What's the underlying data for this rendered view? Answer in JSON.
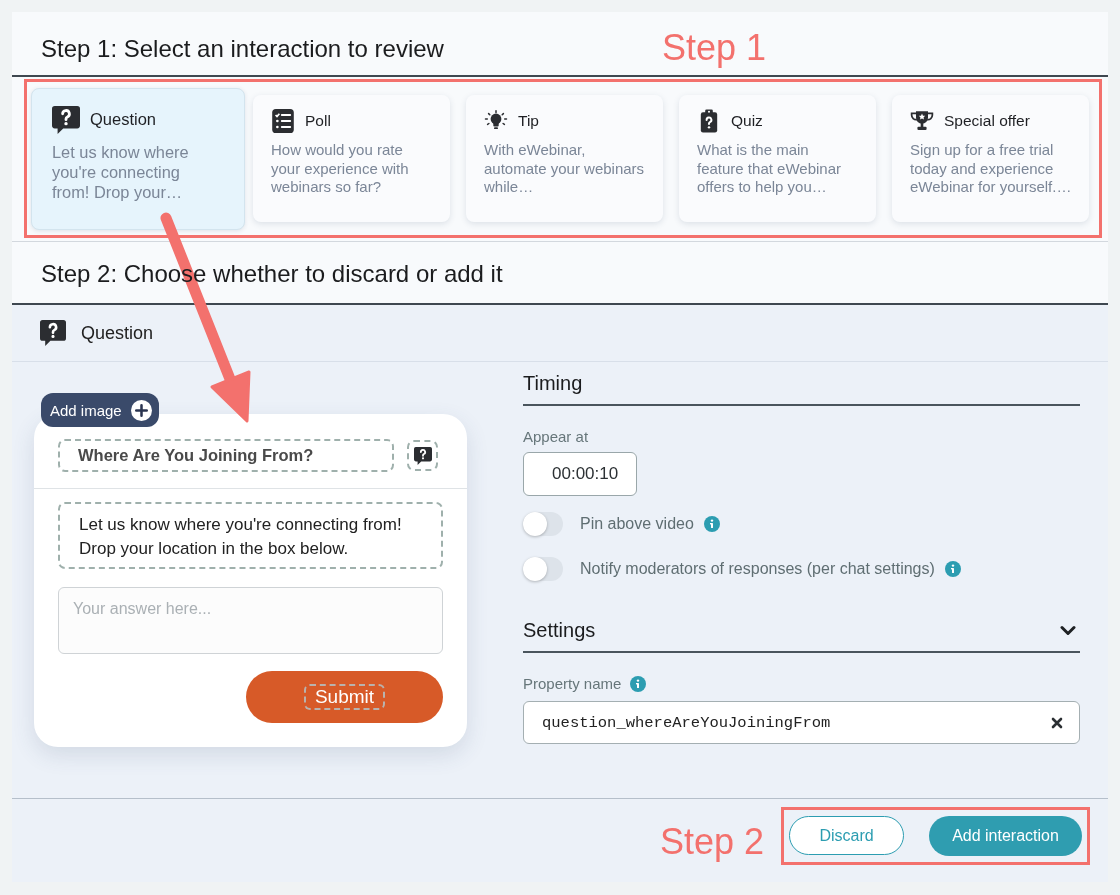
{
  "step1": {
    "title": "Step 1: Select an interaction to review",
    "callout": "Step 1",
    "interactions": [
      {
        "kind": "question",
        "title": "Question",
        "preview": "Let us know where you're connecting from! Drop your…",
        "selected": true
      },
      {
        "kind": "poll",
        "title": "Poll",
        "preview": "How would you rate your experience with webinars so far?",
        "selected": false
      },
      {
        "kind": "tip",
        "title": "Tip",
        "preview": "With eWebinar, automate your webinars while…",
        "selected": false
      },
      {
        "kind": "quiz",
        "title": "Quiz",
        "preview": "What is the main feature that eWebinar offers to help you…",
        "selected": false
      },
      {
        "kind": "offer",
        "title": "Special offer",
        "preview": "Sign up for a free trial today and experience eWebinar for yourself.…",
        "selected": false
      }
    ]
  },
  "step2": {
    "title": "Step 2: Choose whether to discard or add it",
    "interaction": {
      "kind": "question",
      "label": "Question"
    },
    "preview": {
      "add_image": "Add image",
      "question_title": "Where Are You Joining From?",
      "description": "Let us know where you're connecting from! Drop your location in the box below.",
      "answer_placeholder": "Your answer here...",
      "submit": "Submit"
    },
    "timing": {
      "heading": "Timing",
      "appear_at_label": "Appear at",
      "appear_at": "00:00:10",
      "toggles": [
        {
          "label": "Pin above video",
          "on": false
        },
        {
          "label": "Notify moderators of responses (per chat settings)",
          "on": false
        }
      ]
    },
    "settings": {
      "heading": "Settings",
      "expanded": true,
      "property_label": "Property name",
      "property_value": "question_whereAreYouJoiningFrom"
    }
  },
  "footer": {
    "callout": "Step 2",
    "buttons": [
      {
        "kind": "secondary",
        "label": "Discard"
      },
      {
        "kind": "primary",
        "label": "Add interaction"
      }
    ]
  }
}
